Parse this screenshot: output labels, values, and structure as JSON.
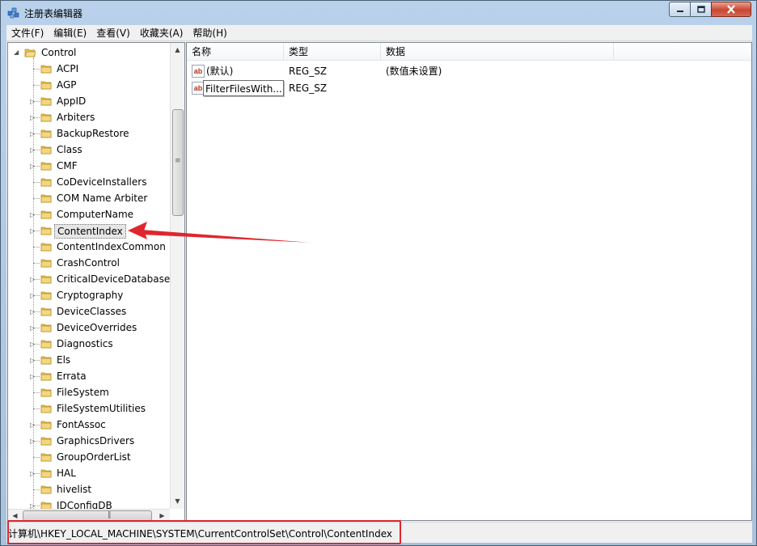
{
  "window": {
    "title": "注册表编辑器"
  },
  "menubar": {
    "items": [
      {
        "label": "文件(F)"
      },
      {
        "label": "编辑(E)"
      },
      {
        "label": "查看(V)"
      },
      {
        "label": "收藏夹(A)"
      },
      {
        "label": "帮助(H)"
      }
    ]
  },
  "tree": {
    "root": {
      "label": "Control",
      "expanded": true
    },
    "children": [
      {
        "label": "ACPI",
        "has_children": false
      },
      {
        "label": "AGP",
        "has_children": false
      },
      {
        "label": "AppID",
        "has_children": true
      },
      {
        "label": "Arbiters",
        "has_children": true
      },
      {
        "label": "BackupRestore",
        "has_children": true
      },
      {
        "label": "Class",
        "has_children": true
      },
      {
        "label": "CMF",
        "has_children": true
      },
      {
        "label": "CoDeviceInstallers",
        "has_children": false
      },
      {
        "label": "COM Name Arbiter",
        "has_children": false
      },
      {
        "label": "ComputerName",
        "has_children": true
      },
      {
        "label": "ContentIndex",
        "has_children": true,
        "selected": true
      },
      {
        "label": "ContentIndexCommon",
        "has_children": false
      },
      {
        "label": "CrashControl",
        "has_children": false
      },
      {
        "label": "CriticalDeviceDatabase",
        "has_children": true
      },
      {
        "label": "Cryptography",
        "has_children": true
      },
      {
        "label": "DeviceClasses",
        "has_children": true
      },
      {
        "label": "DeviceOverrides",
        "has_children": true
      },
      {
        "label": "Diagnostics",
        "has_children": true
      },
      {
        "label": "Els",
        "has_children": true
      },
      {
        "label": "Errata",
        "has_children": true
      },
      {
        "label": "FileSystem",
        "has_children": false
      },
      {
        "label": "FileSystemUtilities",
        "has_children": false
      },
      {
        "label": "FontAssoc",
        "has_children": true
      },
      {
        "label": "GraphicsDrivers",
        "has_children": true
      },
      {
        "label": "GroupOrderList",
        "has_children": false
      },
      {
        "label": "HAL",
        "has_children": true
      },
      {
        "label": "hivelist",
        "has_children": false
      },
      {
        "label": "IDConfigDB",
        "has_children": true
      }
    ]
  },
  "list": {
    "columns": [
      {
        "label": "名称"
      },
      {
        "label": "类型"
      },
      {
        "label": "数据"
      }
    ],
    "rows": [
      {
        "name": "(默认)",
        "type": "REG_SZ",
        "data": "(数值未设置)",
        "icon": "ab-string-icon"
      },
      {
        "name": "FilterFilesWith...",
        "type": "REG_SZ",
        "data": "",
        "icon": "ab-string-icon",
        "editing": true
      }
    ]
  },
  "statusbar": {
    "path": "计算机\\HKEY_LOCAL_MACHINE\\SYSTEM\\CurrentControlSet\\Control\\ContentIndex"
  },
  "colors": {
    "annotation": "#e0262d",
    "folder": "#e8c45a"
  }
}
